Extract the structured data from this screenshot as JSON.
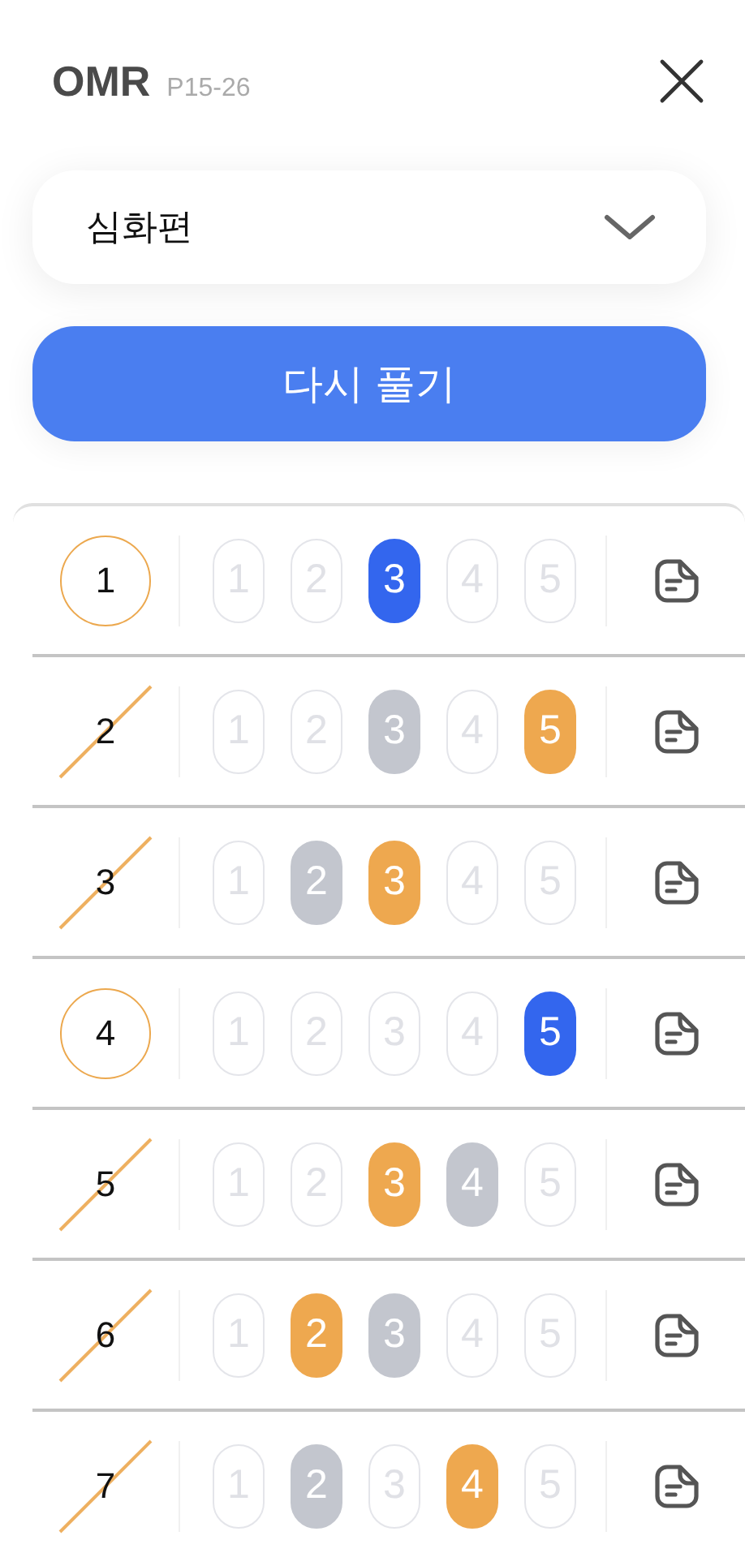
{
  "header": {
    "title": "OMR",
    "pages": "P15-26"
  },
  "dropdown": {
    "value": "심화편"
  },
  "retry_button": {
    "label": "다시 풀기"
  },
  "questions": [
    {
      "number": "1",
      "correct": true,
      "options": [
        {
          "label": "1",
          "selected": false,
          "answer": false
        },
        {
          "label": "2",
          "selected": false,
          "answer": false
        },
        {
          "label": "3",
          "selected": true,
          "answer": true
        },
        {
          "label": "4",
          "selected": false,
          "answer": false
        },
        {
          "label": "5",
          "selected": false,
          "answer": false
        }
      ]
    },
    {
      "number": "2",
      "correct": false,
      "options": [
        {
          "label": "1",
          "selected": false,
          "answer": false
        },
        {
          "label": "2",
          "selected": false,
          "answer": false
        },
        {
          "label": "3",
          "selected": false,
          "answer": true
        },
        {
          "label": "4",
          "selected": false,
          "answer": false
        },
        {
          "label": "5",
          "selected": true,
          "answer": false
        }
      ]
    },
    {
      "number": "3",
      "correct": false,
      "options": [
        {
          "label": "1",
          "selected": false,
          "answer": false
        },
        {
          "label": "2",
          "selected": false,
          "answer": true
        },
        {
          "label": "3",
          "selected": true,
          "answer": false
        },
        {
          "label": "4",
          "selected": false,
          "answer": false
        },
        {
          "label": "5",
          "selected": false,
          "answer": false
        }
      ]
    },
    {
      "number": "4",
      "correct": true,
      "options": [
        {
          "label": "1",
          "selected": false,
          "answer": false
        },
        {
          "label": "2",
          "selected": false,
          "answer": false
        },
        {
          "label": "3",
          "selected": false,
          "answer": false
        },
        {
          "label": "4",
          "selected": false,
          "answer": false
        },
        {
          "label": "5",
          "selected": true,
          "answer": true
        }
      ]
    },
    {
      "number": "5",
      "correct": false,
      "options": [
        {
          "label": "1",
          "selected": false,
          "answer": false
        },
        {
          "label": "2",
          "selected": false,
          "answer": false
        },
        {
          "label": "3",
          "selected": true,
          "answer": false
        },
        {
          "label": "4",
          "selected": false,
          "answer": true
        },
        {
          "label": "5",
          "selected": false,
          "answer": false
        }
      ]
    },
    {
      "number": "6",
      "correct": false,
      "options": [
        {
          "label": "1",
          "selected": false,
          "answer": false
        },
        {
          "label": "2",
          "selected": true,
          "answer": false
        },
        {
          "label": "3",
          "selected": false,
          "answer": true
        },
        {
          "label": "4",
          "selected": false,
          "answer": false
        },
        {
          "label": "5",
          "selected": false,
          "answer": false
        }
      ]
    },
    {
      "number": "7",
      "correct": false,
      "options": [
        {
          "label": "1",
          "selected": false,
          "answer": false
        },
        {
          "label": "2",
          "selected": false,
          "answer": true
        },
        {
          "label": "3",
          "selected": false,
          "answer": false
        },
        {
          "label": "4",
          "selected": true,
          "answer": false
        },
        {
          "label": "5",
          "selected": false,
          "answer": false
        }
      ]
    }
  ]
}
